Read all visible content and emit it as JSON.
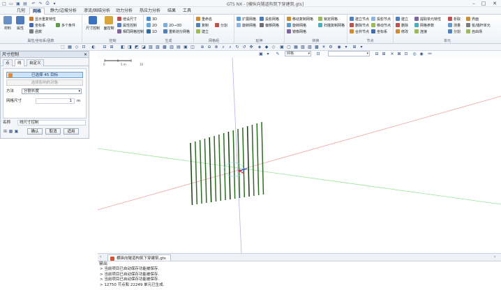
{
  "titlebar": {
    "title": "GTS NX - [横纵向隧道构筑下穿建筑.gts]",
    "quick_access": [
      "new",
      "open",
      "save",
      "save-as",
      "undo",
      "redo",
      "print",
      "dropdown"
    ]
  },
  "menu_tabs": [
    "几何",
    "网格",
    "静力/边坡分析",
    "渗流/固结分析",
    "动力分析",
    "热应力分析",
    "结果",
    "工具"
  ],
  "active_tab": 1,
  "ribbon": {
    "groups": [
      {
        "label": "属性/坐标系/函数",
        "big": [
          "材料",
          "属性"
        ],
        "small": [
          "显示重复特性",
          "坐标系",
          "函数",
          "多个条件"
        ]
      },
      {
        "label": "控制",
        "big": [
          "尺寸控制",
          "面控制"
        ],
        "small": [
          "增设尺寸",
          "属性控制",
          "相同网格控制"
        ]
      },
      {
        "label": "生成",
        "small": [
          "3D",
          "2D",
          "1D",
          "2D→3D",
          "重新划分网格"
        ]
      },
      {
        "label": "网格组",
        "small": [
          "重命名",
          "复制",
          "分割",
          "建立"
        ]
      },
      {
        "label": "延伸",
        "small": [
          "扩展网格",
          "旋转网格",
          "投影网格",
          "偏移网格"
        ]
      },
      {
        "label": "转换",
        "small": [
          "移动复制网格",
          "旋转网格",
          "镜像网格",
          "锁定网格",
          "扫描复制网格"
        ]
      },
      {
        "label": "节点",
        "small": [
          "建立节点",
          "投影节点",
          "删除节点",
          "移动节点",
          "合并节点",
          "坐标系"
        ]
      },
      {
        "label": "单元",
        "small": [
          "建立",
          "删除",
          "修改",
          "提取单元特性",
          "网格参数",
          "连接",
          "析取",
          "测量",
          "分割",
          "自由场",
          "界面",
          "细分网格",
          "桩/锚杆单元"
        ]
      }
    ]
  },
  "panel": {
    "title": "尺寸控制",
    "tabs": [
      "点",
      "线",
      "自定义"
    ],
    "selected_button": "已选择 45 目标",
    "select_assoc_button": "选择影响的对象",
    "method_label": "方法",
    "method_value": "分割长度",
    "mesh_size_label": "网格尺寸",
    "mesh_size_value": "1",
    "mesh_size_unit": "m",
    "name_label": "名称",
    "name_value": "线尺寸控制",
    "buttons": {
      "ok": "确认",
      "cancel": "取消",
      "apply": "适用"
    }
  },
  "viewport": {
    "scale_labels": [
      "0",
      "5 m",
      "10"
    ],
    "display_combo": "网格",
    "colors": {
      "x_axis": "#f1a3a3",
      "y_axis": "#9ae39a",
      "z_axis": "#b3b3ec",
      "mesh_lines": "#2b6b1f",
      "mesh_dark": "#0f3d0a"
    }
  },
  "filetab": {
    "name": "横纵向隧道构筑下穿建筑.gts"
  },
  "output": {
    "title": "输出",
    "lines": [
      "> 当前项目已自动保存功能被保存.",
      "> 当前项目已自动保存功能被保存.",
      "> 当前项目已自动保存功能被保存.",
      "> 12750 节点和 22249 单元已生成."
    ]
  }
}
